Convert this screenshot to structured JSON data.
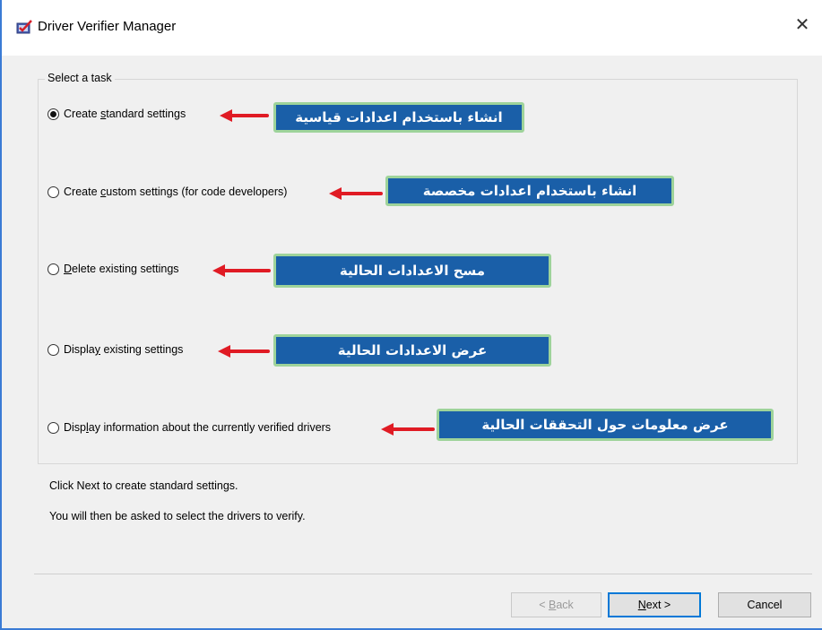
{
  "window": {
    "title": "Driver Verifier Manager",
    "close_glyph": "✕",
    "icon": "checkmark-shield-icon"
  },
  "group": {
    "legend": "Select a task"
  },
  "options": [
    {
      "pre": "Create ",
      "key": "s",
      "post": "tandard settings",
      "selected": true,
      "callout": "انشاء باستخدام اعدادات قياسية"
    },
    {
      "pre": "Create ",
      "key": "c",
      "post": "ustom settings (for code developers)",
      "selected": false,
      "callout": "انشاء باستخدام اعدادات مخصصة"
    },
    {
      "pre": "",
      "key": "D",
      "post": "elete existing settings",
      "selected": false,
      "callout": "مسح الاعدادات الحالية"
    },
    {
      "pre": "Displa",
      "key": "y",
      "post": " existing settings",
      "selected": false,
      "callout": "عرض الاعدادات الحالية"
    },
    {
      "pre": "Disp",
      "key": "l",
      "post": "ay information about the currently verified drivers",
      "selected": false,
      "callout": "عرض معلومات حول التحققات الحالية"
    }
  ],
  "info": {
    "line1": "Click Next to create standard settings.",
    "line2": "You will then be asked to select the drivers to verify."
  },
  "buttons": {
    "back": {
      "pre": "< ",
      "key": "B",
      "post": "ack"
    },
    "next": {
      "pre": "",
      "key": "N",
      "post": "ext >"
    },
    "cancel": "Cancel"
  },
  "colors": {
    "callout_bg": "#1a5fa8",
    "callout_border": "#9ed39a",
    "arrow": "#e01b24",
    "accent": "#0078d7"
  }
}
